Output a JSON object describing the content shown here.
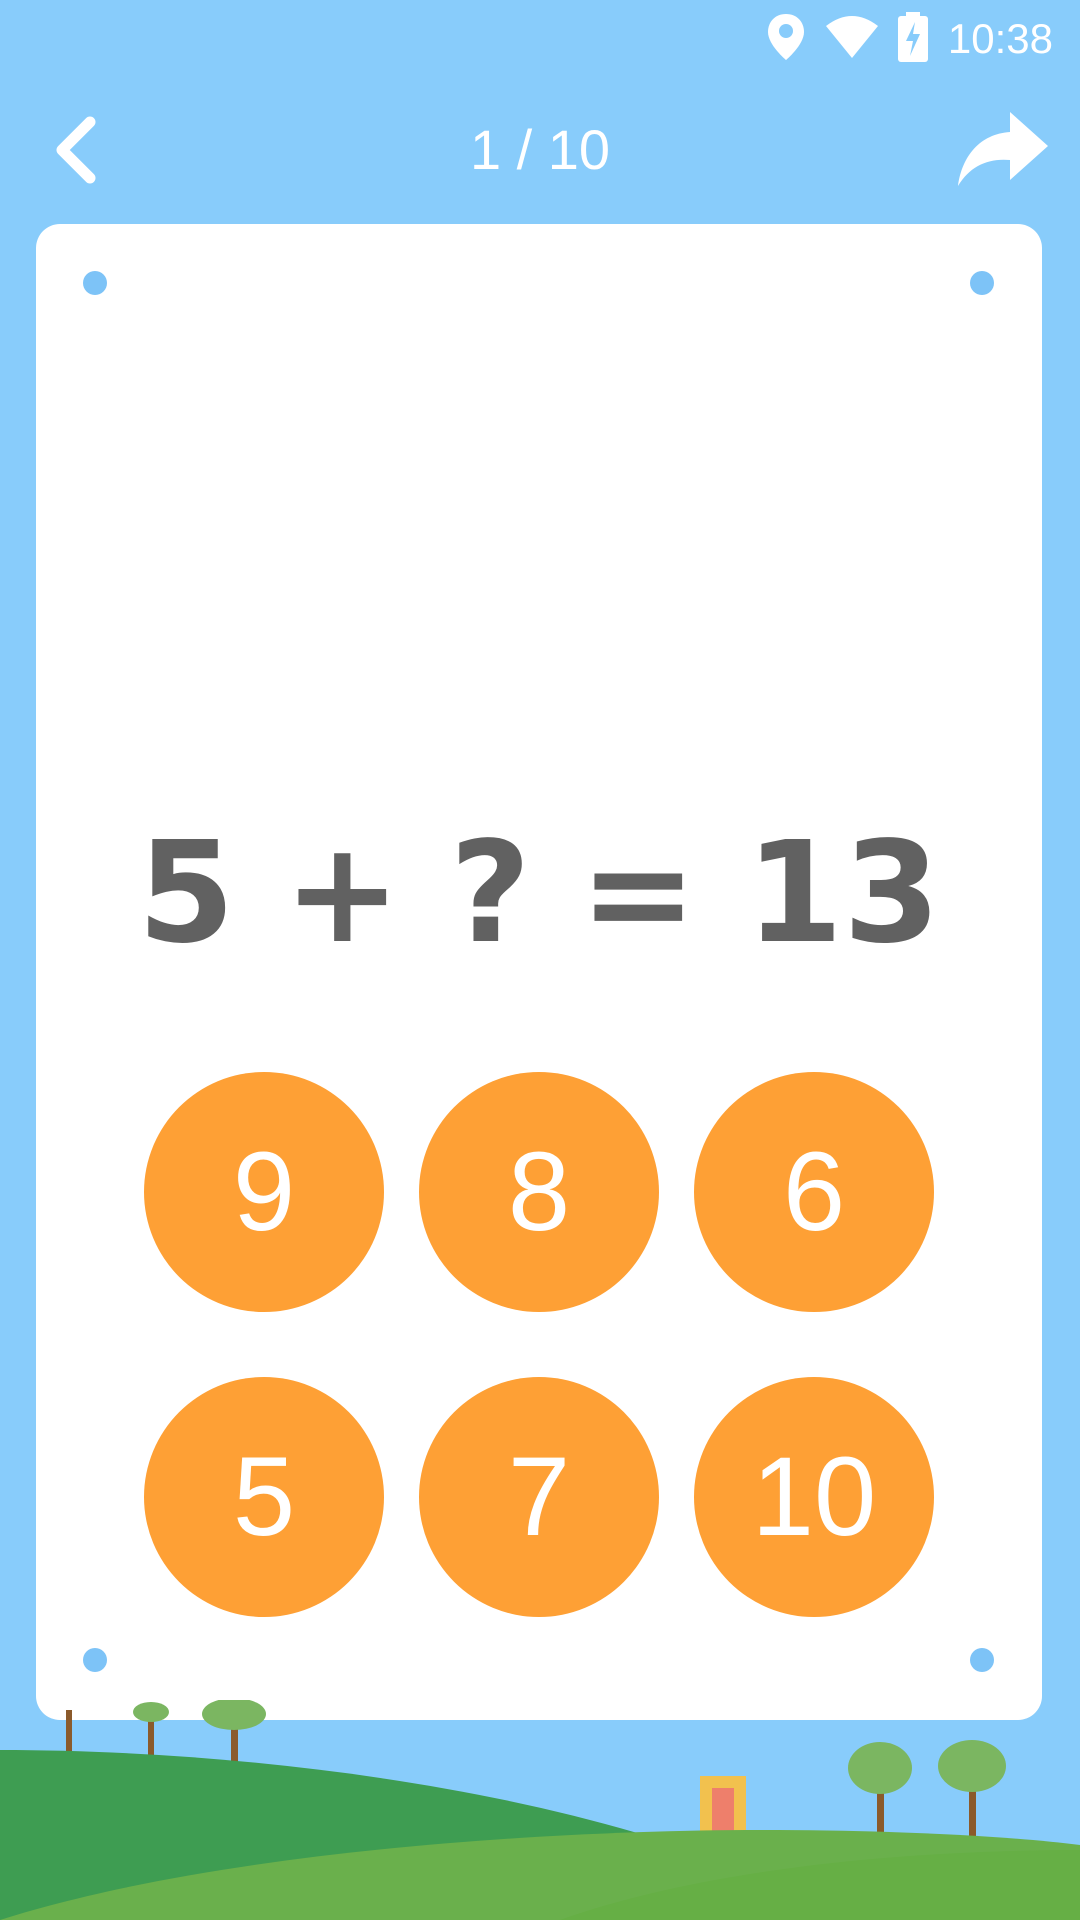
{
  "status_bar": {
    "time": "10:38",
    "icons": [
      "location-icon",
      "wifi-icon",
      "battery-charging-icon"
    ]
  },
  "header": {
    "progress": "1 / 10",
    "back_icon": "chevron-left-icon",
    "share_icon": "share-arrow-icon"
  },
  "question": {
    "equation": "5 + ? = 13"
  },
  "answers": [
    "9",
    "8",
    "6",
    "5",
    "7",
    "10"
  ],
  "colors": {
    "background": "#88CCFB",
    "card": "#FFFFFF",
    "answer_button": "#FEA035",
    "equation_text": "#616161",
    "corner_dot": "#7DC3F7"
  }
}
